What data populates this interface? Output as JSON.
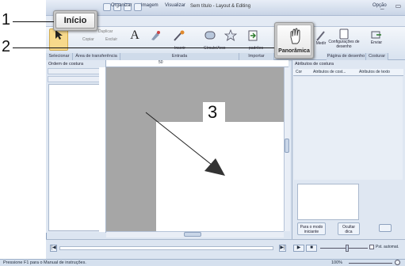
{
  "window": {
    "title": "Sem título - Layout & Editing",
    "option_label": "Opção",
    "window_controls": "_ ▭ ✕"
  },
  "menu": {
    "items": [
      "Organizar",
      "Imagem",
      "Visualizar"
    ]
  },
  "ribbon": {
    "clipboard": {
      "duplicate": "Duplicar",
      "copy": "Copiar",
      "delete": "Excluir"
    },
    "tools": [
      "Texto",
      "Ferramenta",
      "Linha/Pontilh.",
      "Ferramenta",
      "Formas",
      "Importar",
      "Ferramenta"
    ],
    "measure": "Medir",
    "page_settings": "Configurações de desenho",
    "send": "Enviar",
    "groups": [
      "Selecionar",
      "Área de transferência",
      "Entrada",
      "Importar",
      "Página de desenho",
      "Costurar"
    ],
    "subheaders": [
      "Inserir",
      "Círculo/Arco",
      "padrões"
    ]
  },
  "callouts": {
    "home_tab": "Início",
    "panoramic": "Panorâmica",
    "label_1": "1",
    "label_2": "2",
    "label_3": "3"
  },
  "panels": {
    "sewing_order_title": "Ordem de costura",
    "sewing_attr_title": "Atributos de costura",
    "tabs": [
      "Cor",
      "Atributos de cost...",
      "Atributos de texto"
    ],
    "normal_mode_button": "Para o modo iniciante",
    "hide_button": "Ocultar dica"
  },
  "ruler": {
    "marks": [
      "50"
    ]
  },
  "playback": {
    "stitch_simulator": "Pst. automat."
  },
  "status": {
    "text": "Pressione  F1  para o Manual de instruções.",
    "zoom": "100%"
  },
  "colors": {
    "ribbon_bg": "#dce5f1",
    "canvas_gray": "#a6a6a6",
    "accent": "#1f5fa8"
  }
}
